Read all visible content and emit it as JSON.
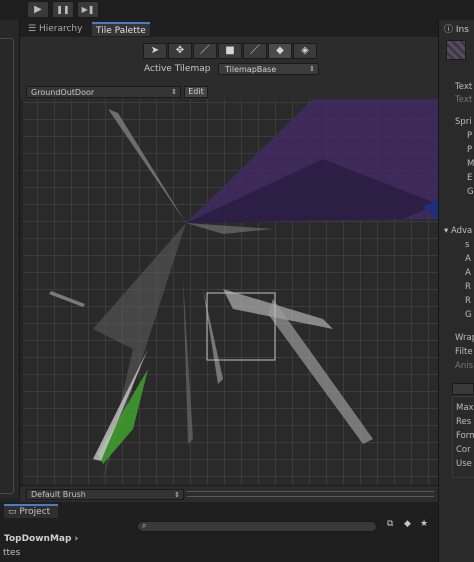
{
  "toolbar": {
    "play": "▶",
    "pause": "❚❚",
    "step": "▶❚"
  },
  "tabs": {
    "hierarchy": "Hierarchy",
    "tile_palette": "Tile Palette",
    "inspector": "Ins"
  },
  "tile_palette": {
    "active_tilemap_label": "Active Tilemap",
    "active_tilemap_value": "TilemapBase",
    "palette_value": "GroundOutDoor",
    "edit_button": "Edit",
    "brush_value": "Default Brush"
  },
  "tools": [
    "select-icon",
    "move-icon",
    "paintbrush-icon",
    "box-fill-icon",
    "picker-icon",
    "eraser-icon",
    "fill-icon"
  ],
  "inspector": {
    "labels": [
      "Text",
      "Text",
      "Spri",
      "P",
      "P",
      "M",
      "E",
      "G",
      "Adva",
      "s",
      "A",
      "A",
      "R",
      "R",
      "G",
      "Wrap",
      "Filte",
      "Anis",
      "Max",
      "Res",
      "Form",
      "Cor",
      "Use"
    ]
  },
  "project": {
    "tab": "Project",
    "breadcrumb": "TopDownMap",
    "partial_item": "ttes"
  },
  "colors": {
    "bg": "#232323",
    "panel": "#282828",
    "grid": "#2a2a2a",
    "accent_purple": "#3f2a5e",
    "accent_green": "#3f9a2f"
  }
}
